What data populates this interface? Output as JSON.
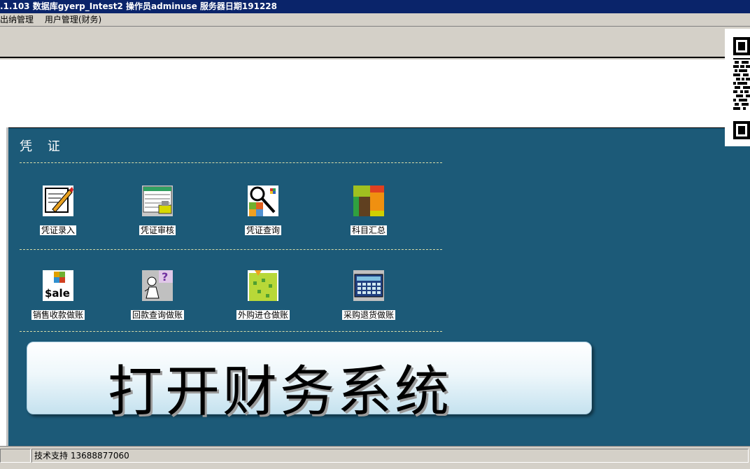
{
  "window": {
    "title": ".1.103  数据库gyerp_Intest2  操作员adminuse  服务器日期191228"
  },
  "menu": {
    "items": [
      "出纳管理",
      "用户管理(财务)"
    ]
  },
  "panel": {
    "title": "凭 证",
    "row1": [
      {
        "label": "凭证录入",
        "icon": "pencil-paper-icon"
      },
      {
        "label": "凭证审核",
        "icon": "ledger-stamp-icon"
      },
      {
        "label": "凭证查询",
        "icon": "magnifier-blocks-icon"
      },
      {
        "label": "科目汇总",
        "icon": "summary-blocks-icon"
      }
    ],
    "row2": [
      {
        "label": "销售收款做账",
        "icon": "sale-icon"
      },
      {
        "label": "回款查询做账",
        "icon": "question-person-icon"
      },
      {
        "label": "外购进仓做账",
        "icon": "green-board-icon"
      },
      {
        "label": "采购退货做账",
        "icon": "calculator-icon"
      }
    ]
  },
  "banner": {
    "text": "打开财务系统"
  },
  "status": {
    "support": "技术支持 13688877060"
  },
  "colors": {
    "titlebar": "#0a246a",
    "panel": "#1c5a78"
  }
}
